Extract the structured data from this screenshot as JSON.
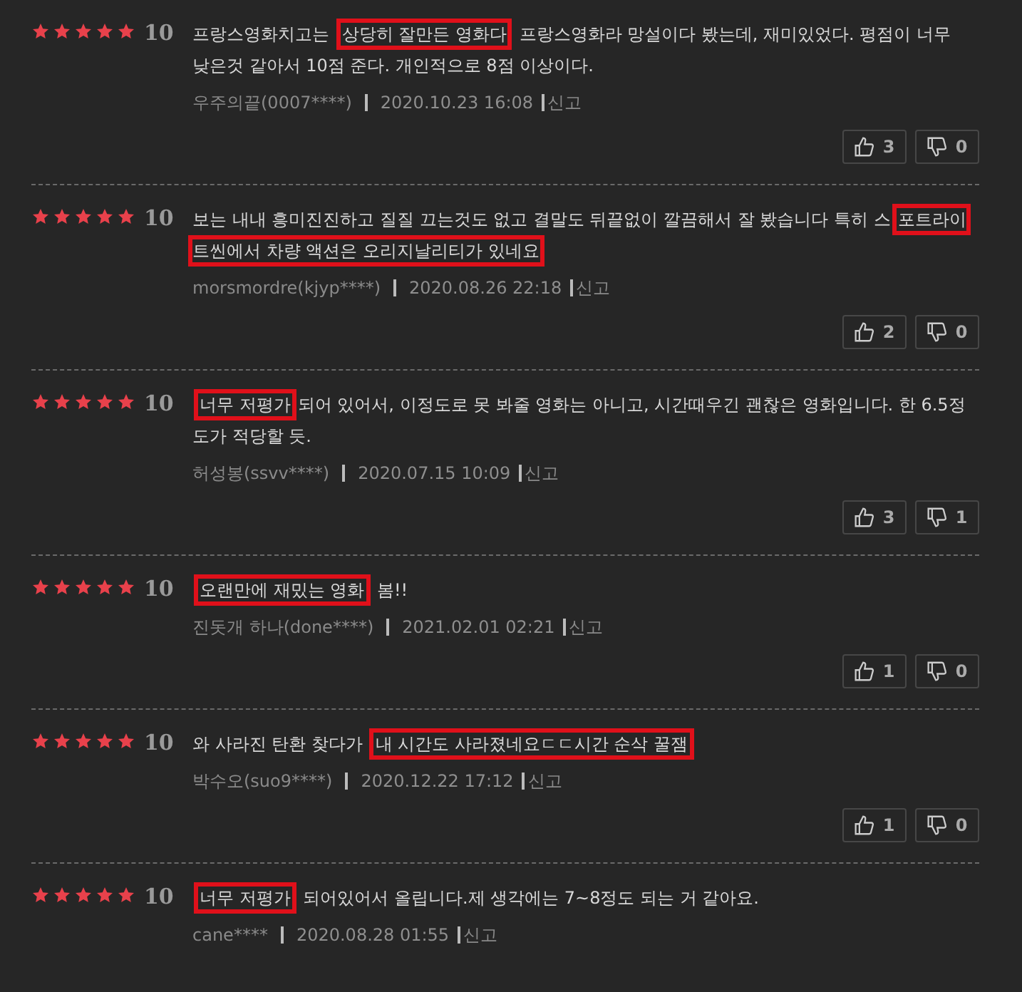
{
  "reviews": [
    {
      "stars": 5,
      "score": "10",
      "parts": [
        {
          "text": "프랑스영화치고는 ",
          "highlighted": false
        },
        {
          "text": "상당히 잘만든 영화다",
          "highlighted": true
        },
        {
          "text": " 프랑스영화라 망설이다 봤는데, 재미있었다. 평점이 너무 낮은것 같아서 10점 준다. 개인적으로 8점 이상이다.",
          "highlighted": false
        }
      ],
      "author": "우주의끝(0007****)",
      "date": "2020.10.23 16:08",
      "report": "신고",
      "likes": "3",
      "dislikes": "0"
    },
    {
      "stars": 5,
      "score": "10",
      "parts": [
        {
          "text": "보는 내내 흥미진진하고 질질 끄는것도 없고 결말도 뒤끝없이 깔끔해서 잘 봤습니다 특히 스",
          "highlighted": false
        },
        {
          "text": "포트라이트씬에서 차량 액션은 오리지날리티가 있네요",
          "highlighted": true
        }
      ],
      "author": "morsmordre(kjyp****)",
      "date": "2020.08.26 22:18",
      "report": "신고",
      "likes": "2",
      "dislikes": "0"
    },
    {
      "stars": 5,
      "score": "10",
      "parts": [
        {
          "text": "너무 저평가",
          "highlighted": true
        },
        {
          "text": "되어 있어서, 이정도로 못 봐줄 영화는 아니고, 시간때우긴 괜찮은 영화입니다. 한 6.5정도가 적당할 듯.",
          "highlighted": false
        }
      ],
      "author": "허성봉(ssvv****)",
      "date": "2020.07.15 10:09",
      "report": "신고",
      "likes": "3",
      "dislikes": "1"
    },
    {
      "stars": 5,
      "score": "10",
      "parts": [
        {
          "text": "오랜만에 재밌는 영화",
          "highlighted": true
        },
        {
          "text": " 봄!!",
          "highlighted": false
        }
      ],
      "author": "진돗개 하나(done****)",
      "date": "2021.02.01 02:21",
      "report": "신고",
      "likes": "1",
      "dislikes": "0"
    },
    {
      "stars": 5,
      "score": "10",
      "parts": [
        {
          "text": "와 사라진 탄환 찾다가 ",
          "highlighted": false
        },
        {
          "text": "내 시간도 사라졌네요ㄷㄷ시간 순삭 꿀잼",
          "highlighted": true
        }
      ],
      "author": "박수오(suo9****)",
      "date": "2020.12.22 17:12",
      "report": "신고",
      "likes": "1",
      "dislikes": "0"
    },
    {
      "stars": 5,
      "score": "10",
      "parts": [
        {
          "text": "너무 저평가",
          "highlighted": true
        },
        {
          "text": " 되어있어서 올립니다.제 생각에는 7~8정도 되는 거 같아요.",
          "highlighted": false
        }
      ],
      "author": "cane****",
      "date": "2020.08.28 01:55",
      "report": "신고"
    }
  ]
}
